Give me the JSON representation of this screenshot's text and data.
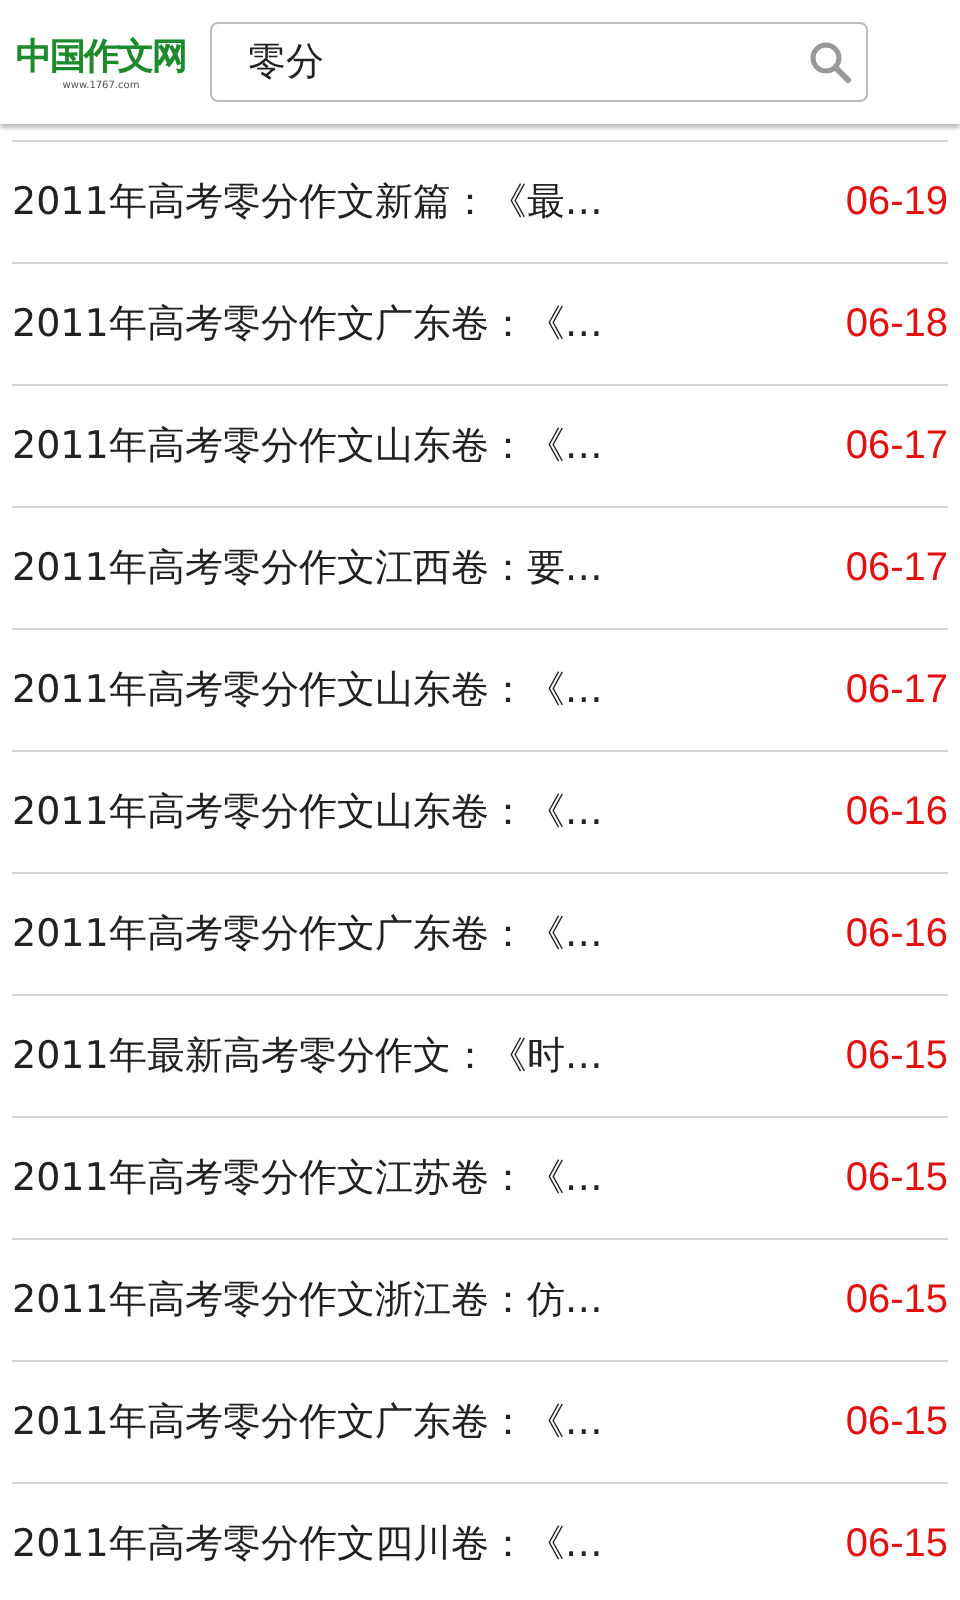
{
  "header": {
    "logo": "中国作文网",
    "logo_url": "www.1767.com",
    "search": {
      "value": "零分"
    }
  },
  "rows": [
    {
      "title": "2011年高考零分作文新篇：《最…",
      "date": "06-19"
    },
    {
      "title": "2011年高考零分作文广东卷：《…",
      "date": "06-18"
    },
    {
      "title": "2011年高考零分作文山东卷：《…",
      "date": "06-17"
    },
    {
      "title": "2011年高考零分作文江西卷：要…",
      "date": "06-17"
    },
    {
      "title": "2011年高考零分作文山东卷：《…",
      "date": "06-17"
    },
    {
      "title": "2011年高考零分作文山东卷：《…",
      "date": "06-16"
    },
    {
      "title": "2011年高考零分作文广东卷：《…",
      "date": "06-16"
    },
    {
      "title": "2011年最新高考零分作文：《时…",
      "date": "06-15"
    },
    {
      "title": "2011年高考零分作文江苏卷：《…",
      "date": "06-15"
    },
    {
      "title": "2011年高考零分作文浙江卷：仿…",
      "date": "06-15"
    },
    {
      "title": "2011年高考零分作文广东卷：《…",
      "date": "06-15"
    },
    {
      "title": "2011年高考零分作文四川卷：《…",
      "date": "06-15"
    }
  ]
}
